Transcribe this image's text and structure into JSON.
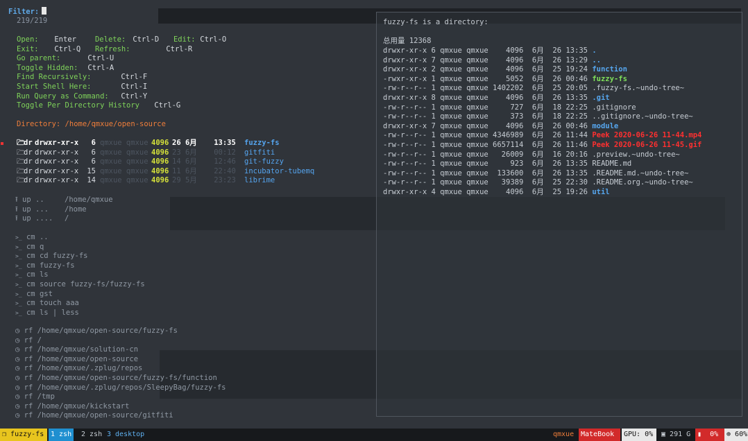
{
  "filter": {
    "label": "Filter:",
    "count": "219/219"
  },
  "help": {
    "rows": [
      [
        [
          "Open:",
          "Enter"
        ],
        [
          "Delete:",
          "Ctrl-D"
        ],
        [
          "Edit:",
          "Ctrl-O"
        ]
      ],
      [
        [
          "Exit:",
          "Ctrl-Q"
        ],
        [
          "Refresh:",
          "Ctrl-R"
        ]
      ],
      [
        [
          "Go parent:",
          "Ctrl-U"
        ]
      ],
      [
        [
          "Toggle Hidden:",
          "Ctrl-A"
        ]
      ],
      [
        [
          "Find Recursively:",
          "Ctrl-F"
        ]
      ],
      [
        [
          "Start Shell Here:",
          "Ctrl-I"
        ]
      ],
      [
        [
          "Run Query as Command:",
          "Ctrl-Y"
        ]
      ],
      [
        [
          "Toggle Per Directory History",
          "Ctrl-G"
        ]
      ]
    ]
  },
  "directory": {
    "label": "Directory:",
    "path": "/home/qmxue/open-source"
  },
  "entries": [
    {
      "type": "dr",
      "perms": "drwxr-xr-x",
      "links": "6",
      "owner": "qmxue qmxue",
      "size": "4096",
      "date": "26 6月",
      "time": "13:35",
      "name": "fuzzy-fs",
      "selected": true
    },
    {
      "type": "dr",
      "perms": "drwxr-xr-x",
      "links": "6",
      "owner": "qmxue qmxue",
      "size": "4096",
      "date": "23 6月",
      "time": "00:12",
      "name": "gitfiti",
      "selected": false
    },
    {
      "type": "dr",
      "perms": "drwxr-xr-x",
      "links": "6",
      "owner": "qmxue qmxue",
      "size": "4096",
      "date": "14 6月",
      "time": "12:46",
      "name": "git-fuzzy",
      "selected": false
    },
    {
      "type": "dr",
      "perms": "drwxr-xr-x",
      "links": "15",
      "owner": "qmxue qmxue",
      "size": "4096",
      "date": "11 6月",
      "time": "22:40",
      "name": "incubator-tubemq",
      "selected": false
    },
    {
      "type": "dr",
      "perms": "drwxr-xr-x",
      "links": "14",
      "owner": "qmxue qmxue",
      "size": "4096",
      "date": "29 5月",
      "time": "23:23",
      "name": "librime",
      "selected": false
    }
  ],
  "up": [
    {
      "tag": "up",
      "dots": "..",
      "path": "/home/qmxue"
    },
    {
      "tag": "up",
      "dots": "...",
      "path": "/home"
    },
    {
      "tag": "up",
      "dots": "....",
      "path": "/"
    }
  ],
  "commands": [
    {
      "tag": "cm",
      "text": ".."
    },
    {
      "tag": "cm",
      "text": "q"
    },
    {
      "tag": "cm",
      "text": "cd fuzzy-fs"
    },
    {
      "tag": "cm",
      "text": "fuzzy-fs"
    },
    {
      "tag": "cm",
      "text": "ls"
    },
    {
      "tag": "cm",
      "text": "source fuzzy-fs/fuzzy-fs"
    },
    {
      "tag": "cm",
      "text": "gst"
    },
    {
      "tag": "cm",
      "text": "touch aaa"
    },
    {
      "tag": "cm",
      "text": "ls | less"
    }
  ],
  "recent": [
    {
      "tag": "rf",
      "path": "/home/qmxue/open-source/fuzzy-fs"
    },
    {
      "tag": "rf",
      "path": "/"
    },
    {
      "tag": "rf",
      "path": "/home/qmxue/solution-cn"
    },
    {
      "tag": "rf",
      "path": "/home/qmxue/open-source"
    },
    {
      "tag": "rf",
      "path": "/home/qmxue/.zplug/repos"
    },
    {
      "tag": "rf",
      "path": "/home/qmxue/open-source/fuzzy-fs/function"
    },
    {
      "tag": "rf",
      "path": "/home/qmxue/.zplug/repos/SleepyBag/fuzzy-fs"
    },
    {
      "tag": "rf",
      "path": "/tmp"
    },
    {
      "tag": "rf",
      "path": "/home/qmxue/kickstart"
    },
    {
      "tag": "rf",
      "path": "/home/qmxue/open-source/gitfiti"
    }
  ],
  "preview": {
    "header": "fuzzy-fs is a directory:",
    "total": "总用量 12368",
    "rows": [
      {
        "meta": "drwxr-xr-x 6 qmxue qmxue    4096  6月  26 13:35",
        "name": ".",
        "kind": "dir"
      },
      {
        "meta": "drwxr-xr-x 7 qmxue qmxue    4096  6月  26 13:29",
        "name": "..",
        "kind": "dir"
      },
      {
        "meta": "drwxr-xr-x 2 qmxue qmxue    4096  6月  25 19:24",
        "name": "function",
        "kind": "dir"
      },
      {
        "meta": "-rwxr-xr-x 1 qmxue qmxue    5052  6月  26 00:46",
        "name": "fuzzy-fs",
        "kind": "exec"
      },
      {
        "meta": "-rw-r--r-- 1 qmxue qmxue 1402202  6月  25 20:05",
        "name": ".fuzzy-fs.~undo-tree~",
        "kind": "file"
      },
      {
        "meta": "drwxr-xr-x 8 qmxue qmxue    4096  6月  26 13:35",
        "name": ".git",
        "kind": "dir"
      },
      {
        "meta": "-rw-r--r-- 1 qmxue qmxue     727  6月  18 22:25",
        "name": ".gitignore",
        "kind": "file"
      },
      {
        "meta": "-rw-r--r-- 1 qmxue qmxue     373  6月  18 22:25",
        "name": "..gitignore.~undo-tree~",
        "kind": "file"
      },
      {
        "meta": "drwxr-xr-x 7 qmxue qmxue    4096  6月  26 00:46",
        "name": "module",
        "kind": "dir"
      },
      {
        "meta": "-rw-r--r-- 1 qmxue qmxue 4346989  6月  26 11:44",
        "name": "Peek 2020-06-26 11-44.mp4",
        "kind": "media"
      },
      {
        "meta": "-rw-r--r-- 1 qmxue qmxue 6657114  6月  26 11:46",
        "name": "Peek 2020-06-26 11-45.gif",
        "kind": "media"
      },
      {
        "meta": "-rw-r--r-- 1 qmxue qmxue   26009  6月  16 20:16",
        "name": ".preview.~undo-tree~",
        "kind": "file"
      },
      {
        "meta": "-rw-r--r-- 1 qmxue qmxue     923  6月  26 13:35",
        "name": "README.md",
        "kind": "file"
      },
      {
        "meta": "-rw-r--r-- 1 qmxue qmxue  133600  6月  26 13:35",
        "name": ".README.md.~undo-tree~",
        "kind": "file"
      },
      {
        "meta": "-rw-r--r-- 1 qmxue qmxue   39389  6月  25 22:30",
        "name": ".README.org.~undo-tree~",
        "kind": "file"
      },
      {
        "meta": "drwxr-xr-x 4 qmxue qmxue    4096  6月  25 19:26",
        "name": "util",
        "kind": "dir"
      }
    ]
  },
  "statusbar": {
    "session": "fuzzy-fs",
    "windows": [
      {
        "label": "1 zsh",
        "active": true
      },
      {
        "label": "2 zsh",
        "active": false
      },
      {
        "label": "3 desktop",
        "active": false
      }
    ],
    "user": "qmxue",
    "host": "MateBook",
    "gpu": "GPU: 0%",
    "disk": "291 G",
    "cpu": "0%",
    "battery": "60%"
  },
  "colors": {
    "background": "#30343a",
    "filter_label": "#5fa8e6",
    "help_key": "#7fd35a",
    "directory_path": "#ef7e3a",
    "dir_name": "#55a4ee",
    "size": "#d6e23a",
    "media": "#ff3030",
    "session_bg": "#e8c51e",
    "host_bg": "#d22a2a"
  }
}
